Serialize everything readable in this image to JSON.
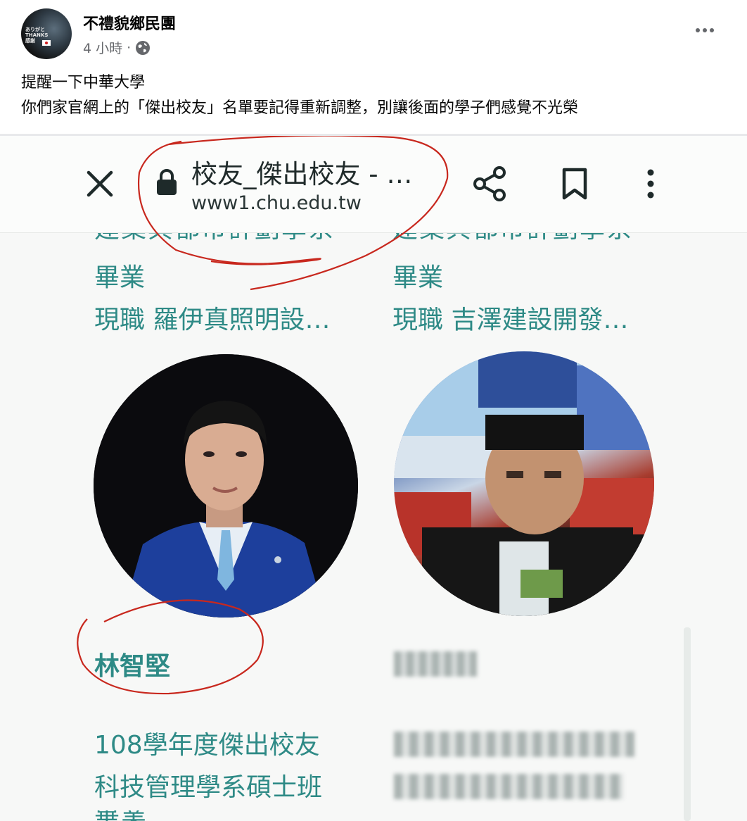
{
  "post": {
    "page_name": "不禮貌鄉民團",
    "time": "4 小時",
    "separator": "·",
    "avatar_text": "ありがと THANKS 感謝",
    "text_line1": "提醒一下中華大學",
    "text_line2": "你們家官網上的「傑出校友」名單要記得重新調整，別讓後面的學子們感覺不光榮"
  },
  "browser": {
    "tab_title": "校友_傑出校友 - …",
    "url": "www1.chu.edu.tw"
  },
  "alumni": {
    "left_top": {
      "cut_line": "建築與都市計劃學系",
      "graduated": "畢業",
      "job": "現職 羅伊真照明設…"
    },
    "right_top": {
      "cut_line": "建築與都市計劃學系",
      "graduated": "畢業",
      "job": "現職 吉澤建設開發…"
    },
    "left_bottom": {
      "name": "林智堅",
      "award": "108學年度傑出校友",
      "dept": "科技管理學系碩士班"
    }
  },
  "colors": {
    "accent_teal": "#2e8a86",
    "annotation_red": "#c8281e",
    "meta_gray": "#65676b"
  }
}
